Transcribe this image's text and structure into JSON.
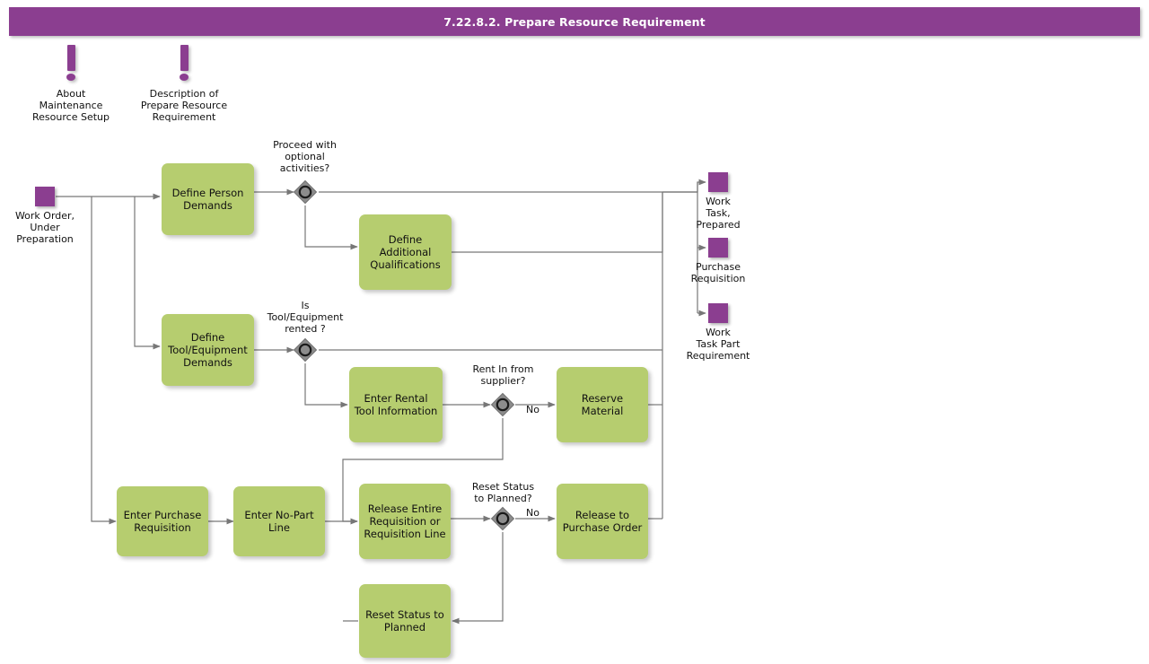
{
  "header": {
    "title": "7.22.8.2. Prepare Resource Requirement"
  },
  "annotations": [
    {
      "icon": "exclamation-info-icon",
      "label": "About\nMaintenance\nResource Setup"
    },
    {
      "icon": "exclamation-info-icon",
      "label": "Description of\nPrepare Resource\nRequirement"
    }
  ],
  "events": {
    "start": {
      "label": "Work Order,\nUnder\nPreparation"
    },
    "end_work_task_prepared": {
      "label": "Work\nTask,\nPrepared"
    },
    "end_purchase_requisition": {
      "label": "Purchase\nRequisition"
    },
    "end_work_task_part_requirement": {
      "label": "Work\nTask Part\nRequirement"
    }
  },
  "tasks": {
    "define_person_demands": {
      "label": "Define Person\nDemands"
    },
    "define_additional_qualifications": {
      "label": "Define\nAdditional\nQualifications"
    },
    "define_tool_equipment_demands": {
      "label": "Define\nTool/Equipment\nDemands"
    },
    "enter_rental_tool_information": {
      "label": "Enter Rental\nTool Information"
    },
    "reserve_material": {
      "label": "Reserve Material"
    },
    "enter_purchase_requisition": {
      "label": "Enter Purchase\nRequisition"
    },
    "enter_no_part_line": {
      "label": "Enter No-Part\nLine"
    },
    "release_entire_requisition": {
      "label": "Release Entire\nRequisition or\nRequisition Line"
    },
    "release_to_purchase_order": {
      "label": "Release to\nPurchase Order"
    },
    "reset_status_to_planned": {
      "label": "Reset Status to\nPlanned"
    }
  },
  "gateways": {
    "proceed_optional": {
      "label": "Proceed with\noptional\nactivities?"
    },
    "tool_rented": {
      "label": "Is\nTool/Equipment\nrented ?"
    },
    "rent_in_supplier": {
      "label": "Rent In from\nsupplier?"
    },
    "reset_status": {
      "label": "Reset Status\nto Planned?"
    }
  },
  "edge_labels": {
    "rent_in_no": "No",
    "reset_status_no": "No"
  },
  "colors": {
    "title_bar": "#8b3e90",
    "event": "#8b3e90",
    "task_fill": "#b6cd6f",
    "gateway_fill": "#6f6f6f",
    "connector": "#777777",
    "text": "#111111"
  }
}
